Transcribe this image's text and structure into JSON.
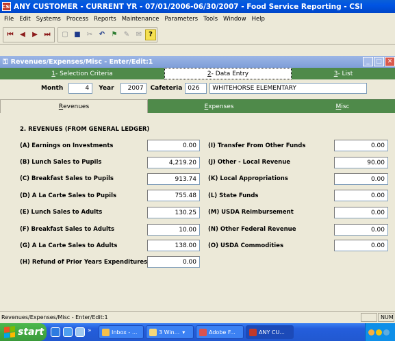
{
  "window": {
    "title": "ANY CUSTOMER - CURRENT YR - 07/01/2006-06/30/2007 - Food Service Reporting - CSI",
    "icon_text": "CSI"
  },
  "menu": [
    "File",
    "Edit",
    "Systems",
    "Process",
    "Reports",
    "Maintenance",
    "Parameters",
    "Tools",
    "Window",
    "Help"
  ],
  "toolbar": {
    "icons": [
      "first-record-icon",
      "previous-record-icon",
      "next-record-icon",
      "last-record-icon",
      "new-icon",
      "save-icon",
      "cut-icon",
      "undo-icon",
      "filter-icon",
      "edit-icon",
      "attachment-icon",
      "help-icon"
    ]
  },
  "child": {
    "title": "Revenues/Expenses/Misc - Enter/Edit:1"
  },
  "wizard_tabs": [
    {
      "key": "1",
      "label": " - Selection Criteria"
    },
    {
      "key": "2",
      "label": " - Data Entry"
    },
    {
      "key": "3",
      "label": " - List"
    }
  ],
  "header": {
    "month_label": "Month",
    "month_value": "4",
    "year_label": "Year",
    "year_value": "2007",
    "cafeteria_label": "Cafeteria",
    "cafeteria_code": "026",
    "cafeteria_name": "WHITEHORSE ELEMENTARY"
  },
  "sub_tabs": [
    {
      "key": "R",
      "rest": "evenues"
    },
    {
      "key": "E",
      "rest": "xpenses"
    },
    {
      "key": "M",
      "rest": "isc"
    }
  ],
  "section": {
    "title": "2. REVENUES (FROM GENERAL LEDGER)"
  },
  "fields_left": [
    {
      "label": "(A) Earnings on Investments",
      "value": "0.00"
    },
    {
      "label": "(B) Lunch Sales to Pupils",
      "value": "4,219.20"
    },
    {
      "label": "(C) Breakfast Sales to Pupils",
      "value": "913.74"
    },
    {
      "label": "(D) A La Carte Sales to Pupils",
      "value": "755.48"
    },
    {
      "label": "(E) Lunch Sales to Adults",
      "value": "130.25"
    },
    {
      "label": "(F) Breakfast Sales to Adults",
      "value": "10.00"
    },
    {
      "label": "(G) A La Carte Sales to Adults",
      "value": "138.00"
    },
    {
      "label": "(H) Refund of Prior Years Expenditures",
      "value": "0.00"
    }
  ],
  "fields_right": [
    {
      "label": "(I) Transfer From Other Funds",
      "value": "0.00"
    },
    {
      "label": "(J) Other - Local Revenue",
      "value": "90.00"
    },
    {
      "label": "(K) Local Appropriations",
      "value": "0.00"
    },
    {
      "label": "(L) State Funds",
      "value": "0.00"
    },
    {
      "label": "(M) USDA Reimbursement",
      "value": "0.00"
    },
    {
      "label": "(N) Other Federal Revenue",
      "value": "0.00"
    },
    {
      "label": "(O) USDA Commodities",
      "value": "0.00"
    }
  ],
  "status": {
    "text": "Revenues/Expenses/Misc - Enter/Edit:1",
    "num": "NUM"
  },
  "taskbar": {
    "start": "start",
    "tasks": [
      "Inbox - ...",
      "3 Win...",
      "Adobe F...",
      "ANY CU..."
    ]
  },
  "colors": {
    "wizard_green": "#4F8A4A",
    "title_blue": "#0054E3",
    "child_title": "#7E9ED8"
  }
}
